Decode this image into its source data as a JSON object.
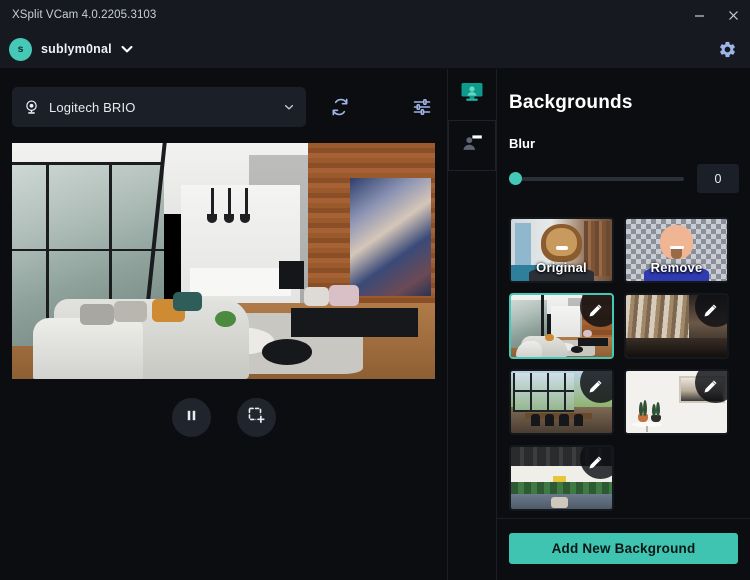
{
  "window": {
    "title": "XSplit VCam 4.0.2205.3103",
    "minimize_label": "Minimize",
    "close_label": "Close"
  },
  "account": {
    "avatar_initial": "s",
    "username": "sublym0nal",
    "caret_icon": "chevron-down-icon",
    "settings_icon": "gear-icon"
  },
  "device": {
    "camera_icon": "webcam-icon",
    "selected": "Logitech BRIO",
    "caret_icon": "chevron-down-icon",
    "refresh_icon": "refresh-icon",
    "tune_icon": "sliders-icon"
  },
  "preview": {
    "scene_label": "modern living room",
    "pause_label": "Pause",
    "pause_icon": "pause-icon",
    "snapshot_label": "Add snapshot",
    "snapshot_icon": "selection-add-icon"
  },
  "rail": {
    "items": [
      {
        "name": "backgrounds",
        "icon": "monitor-person-icon",
        "active": true
      },
      {
        "name": "user",
        "icon": "person-card-icon",
        "active": false
      }
    ]
  },
  "panel": {
    "title": "Backgrounds",
    "blur": {
      "label": "Blur",
      "value": "0",
      "min": 0,
      "max": 100,
      "percent": 0
    },
    "backgrounds": [
      {
        "id": "original",
        "caption": "Original",
        "art": "office",
        "selected": false,
        "editable": false
      },
      {
        "id": "remove",
        "caption": "Remove",
        "art": "checker",
        "selected": false,
        "editable": false
      },
      {
        "id": "bg-living-room",
        "caption": "",
        "art": "living",
        "selected": true,
        "editable": true
      },
      {
        "id": "bg-corridor",
        "caption": "",
        "art": "corridor",
        "selected": false,
        "editable": true
      },
      {
        "id": "bg-dining",
        "caption": "",
        "art": "dining",
        "selected": false,
        "editable": true
      },
      {
        "id": "bg-plants",
        "caption": "",
        "art": "plants",
        "selected": false,
        "editable": true
      },
      {
        "id": "bg-loft",
        "caption": "",
        "art": "loft",
        "selected": false,
        "editable": true
      }
    ],
    "add_button": "Add New Background"
  },
  "colors": {
    "accent": "#3fc4b2",
    "accent_avatar": "#45c9b6",
    "icon_blue": "#9fb4e8",
    "app_bg": "#0b0d10",
    "bar_bg": "#16191f",
    "field_bg": "#1b1f27"
  }
}
